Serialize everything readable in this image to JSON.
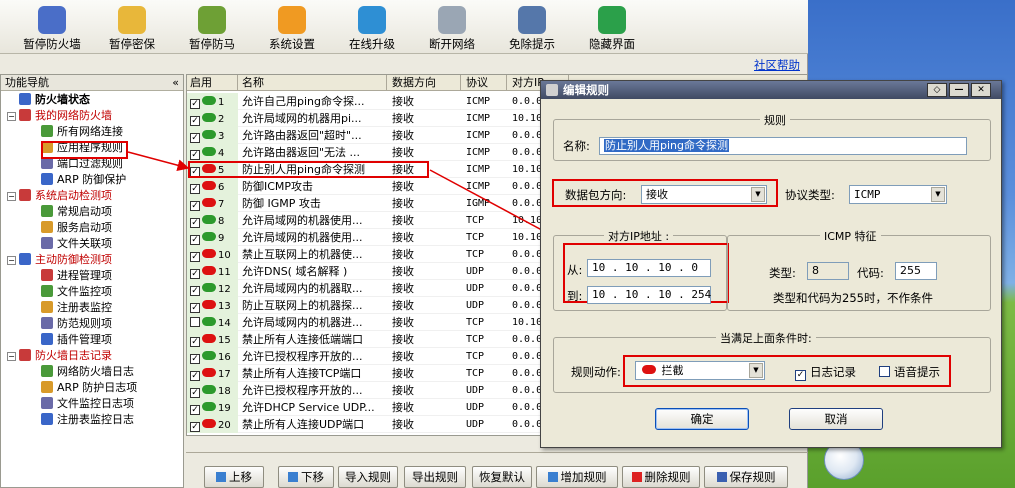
{
  "toolbar": {
    "buttons": [
      {
        "label": "暂停防火墙",
        "icon": "firewall-icon",
        "color": "#4a6ec8"
      },
      {
        "label": "暂停密保",
        "icon": "folder-lock-icon",
        "color": "#e8b73a"
      },
      {
        "label": "暂停防马",
        "icon": "shield-icon",
        "color": "#6ea035"
      },
      {
        "label": "系统设置",
        "icon": "gear-icon",
        "color": "#f09a22"
      },
      {
        "label": "在线升级",
        "icon": "globe-icon",
        "color": "#2e8fd4"
      },
      {
        "label": "断开网络",
        "icon": "gauge-icon",
        "color": "#9aa6b4"
      },
      {
        "label": "免除提示",
        "icon": "speaker-icon",
        "color": "#5577aa"
      },
      {
        "label": "隐藏界面",
        "icon": "arrow-return-icon",
        "color": "#2ba04a"
      }
    ]
  },
  "links": {
    "community": "社区帮助"
  },
  "nav": {
    "header": "功能导航",
    "collapse": "«",
    "items": [
      {
        "label": "防火墙状态",
        "level": 0,
        "kind": "root"
      },
      {
        "label": "我的网络防火墙",
        "level": 0,
        "kind": "group"
      },
      {
        "label": "所有网络连接",
        "level": 1
      },
      {
        "label": "应用程序规则",
        "level": 1
      },
      {
        "label": "端口过滤规则",
        "level": 1
      },
      {
        "label": "ARP 防御保护",
        "level": 1
      },
      {
        "label": "系统启动检测项",
        "level": 0,
        "kind": "group"
      },
      {
        "label": "常规启动项",
        "level": 1
      },
      {
        "label": "服务启动项",
        "level": 1
      },
      {
        "label": "文件关联项",
        "level": 1
      },
      {
        "label": "主动防御检测项",
        "level": 0,
        "kind": "group"
      },
      {
        "label": "进程管理项",
        "level": 1
      },
      {
        "label": "文件监控项",
        "level": 1
      },
      {
        "label": "注册表监控",
        "level": 1
      },
      {
        "label": "防范规则项",
        "level": 1
      },
      {
        "label": "插件管理项",
        "level": 1
      },
      {
        "label": "防火墙日志记录",
        "level": 0,
        "kind": "group"
      },
      {
        "label": "网络防火墙日志",
        "level": 1
      },
      {
        "label": "ARP 防护日志项",
        "level": 1
      },
      {
        "label": "文件监控日志项",
        "level": 1
      },
      {
        "label": "注册表监控日志",
        "level": 1
      }
    ]
  },
  "grid": {
    "headers": [
      "启用",
      "名称",
      "数据方向",
      "协议",
      "对方IP"
    ],
    "rows": [
      {
        "checked": true,
        "action": "allow",
        "num": "1",
        "name": "允许自己用ping命令探...",
        "dir": "接收",
        "proto": "ICMP",
        "ip": "0.0.0"
      },
      {
        "checked": true,
        "action": "allow",
        "num": "2",
        "name": "允许局域网的机器用pi...",
        "dir": "接收",
        "proto": "ICMP",
        "ip": "10.10"
      },
      {
        "checked": true,
        "action": "allow",
        "num": "3",
        "name": "允许路由器返回\"超时\"...",
        "dir": "接收",
        "proto": "ICMP",
        "ip": "0.0.0"
      },
      {
        "checked": true,
        "action": "allow",
        "num": "4",
        "name": "允许路由器返回\"无法 ...",
        "dir": "接收",
        "proto": "ICMP",
        "ip": "0.0.0"
      },
      {
        "checked": true,
        "action": "block",
        "num": "5",
        "name": "防止别人用ping命令探测",
        "dir": "接收",
        "proto": "ICMP",
        "ip": "10.10"
      },
      {
        "checked": true,
        "action": "block",
        "num": "6",
        "name": "防御ICMP攻击",
        "dir": "接收",
        "proto": "ICMP",
        "ip": "0.0.0"
      },
      {
        "checked": true,
        "action": "block",
        "num": "7",
        "name": "防御 IGMP 攻击",
        "dir": "接收",
        "proto": "IGMP",
        "ip": "0.0.0"
      },
      {
        "checked": true,
        "action": "allow",
        "num": "8",
        "name": "允许局域网的机器使用...",
        "dir": "接收",
        "proto": "TCP",
        "ip": "10.10"
      },
      {
        "checked": true,
        "action": "allow",
        "num": "9",
        "name": "允许局域网的机器使用...",
        "dir": "接收",
        "proto": "TCP",
        "ip": "10.10"
      },
      {
        "checked": true,
        "action": "block",
        "num": "10",
        "name": "禁止互联网上的机器使...",
        "dir": "接收",
        "proto": "TCP",
        "ip": "0.0.0"
      },
      {
        "checked": true,
        "action": "block",
        "num": "11",
        "name": "允许DNS( 域名解释 )",
        "dir": "接收",
        "proto": "UDP",
        "ip": "0.0.0"
      },
      {
        "checked": true,
        "action": "allow",
        "num": "12",
        "name": "允许局域网内的机器取...",
        "dir": "接收",
        "proto": "UDP",
        "ip": "0.0.0"
      },
      {
        "checked": true,
        "action": "block",
        "num": "13",
        "name": "防止互联网上的机器探...",
        "dir": "接收",
        "proto": "UDP",
        "ip": "0.0.0"
      },
      {
        "checked": false,
        "action": "allow",
        "num": "14",
        "name": "允许局域网内的机器进...",
        "dir": "接收",
        "proto": "TCP",
        "ip": "10.10"
      },
      {
        "checked": true,
        "action": "block",
        "num": "15",
        "name": "禁止所有人连接低端端口",
        "dir": "接收",
        "proto": "TCP",
        "ip": "0.0.0"
      },
      {
        "checked": true,
        "action": "allow",
        "num": "16",
        "name": "允许已授权程序开放的...",
        "dir": "接收",
        "proto": "TCP",
        "ip": "0.0.0"
      },
      {
        "checked": true,
        "action": "block",
        "num": "17",
        "name": "禁止所有人连接TCP端口",
        "dir": "接收",
        "proto": "TCP",
        "ip": "0.0.0"
      },
      {
        "checked": true,
        "action": "allow",
        "num": "18",
        "name": "允许已授权程序开放的...",
        "dir": "接收",
        "proto": "UDP",
        "ip": "0.0.0"
      },
      {
        "checked": true,
        "action": "allow",
        "num": "19",
        "name": "允许DHCP Service UDP...",
        "dir": "接收",
        "proto": "UDP",
        "ip": "0.0.0"
      },
      {
        "checked": true,
        "action": "block",
        "num": "20",
        "name": "禁止所有人连接UDP端口",
        "dir": "接收",
        "proto": "UDP",
        "ip": "0.0.0"
      }
    ]
  },
  "bottom_buttons": [
    {
      "label": "上移",
      "icon": "arrow-up-icon"
    },
    {
      "label": "下移",
      "icon": "arrow-down-icon"
    },
    {
      "label": "导入规则"
    },
    {
      "label": "导出规则"
    },
    {
      "label": "恢复默认"
    },
    {
      "label": "增加规则",
      "icon": "add-rule-icon"
    },
    {
      "label": "删除规则",
      "icon": "delete-x-icon"
    },
    {
      "label": "保存规则",
      "icon": "save-icon"
    }
  ],
  "dialog": {
    "title": "编辑规则",
    "window_buttons": [
      "◇",
      "—",
      "✕"
    ],
    "rule_group": "规则",
    "name_label": "名称:",
    "name_value": "防止别人用ping命令探测",
    "direction_label": "数据包方向:",
    "direction_value": "接收",
    "protocol_label": "协议类型:",
    "protocol_value": "ICMP",
    "ip_group": "对方IP地址 :",
    "from_label": "从:",
    "from_value": "10 . 10 . 10 . 0",
    "to_label": "到:",
    "to_value": "10 . 10 . 10 . 254",
    "icmp_group": "ICMP 特征",
    "type_label": "类型:",
    "type_value": "8",
    "code_label": "代码:",
    "code_value": "255",
    "icmp_note": "类型和代码为255时，不作条件",
    "condition_group": "当满足上面条件时:",
    "action_label": "规则动作:",
    "action_value": "拦截",
    "log_label": "日志记录",
    "log_checked": true,
    "voice_label": "语音提示",
    "voice_checked": false,
    "ok": "确定",
    "cancel": "取消"
  },
  "colors": {
    "highlight": "#e00000",
    "allow": "#2c9a2c",
    "block": "#dd1111"
  }
}
